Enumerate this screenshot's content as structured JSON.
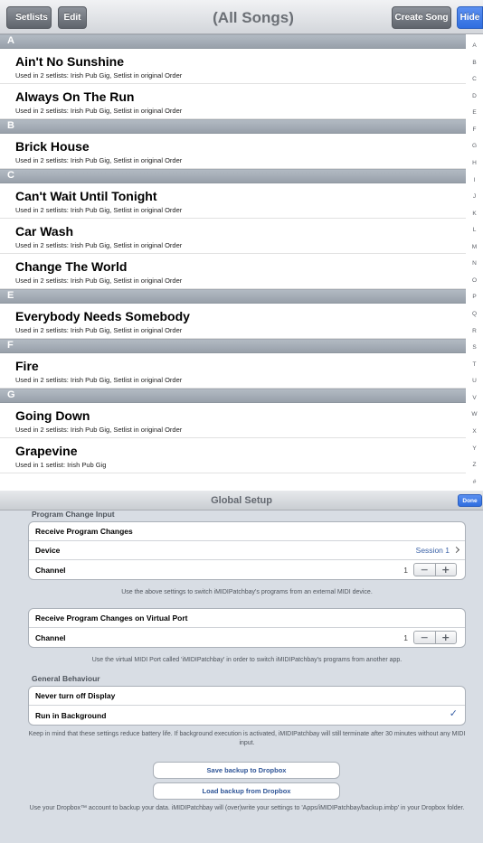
{
  "navbar": {
    "back_label": "Setlists",
    "edit_label": "Edit",
    "title": "(All Songs)",
    "create_label": "Create Song",
    "hide_label": "Hide"
  },
  "sections": [
    {
      "letter": "A",
      "songs": [
        {
          "title": "Ain't No Sunshine",
          "sub": "Used in 2 setlists: Irish Pub Gig, Setlist in original Order"
        },
        {
          "title": "Always On The Run",
          "sub": "Used in 2 setlists: Irish Pub Gig, Setlist in original Order"
        }
      ]
    },
    {
      "letter": "B",
      "songs": [
        {
          "title": "Brick House",
          "sub": "Used in 2 setlists: Irish Pub Gig, Setlist in original Order"
        }
      ]
    },
    {
      "letter": "C",
      "songs": [
        {
          "title": "Can't Wait Until Tonight",
          "sub": "Used in 2 setlists: Irish Pub Gig, Setlist in original Order"
        },
        {
          "title": "Car Wash",
          "sub": "Used in 2 setlists: Irish Pub Gig, Setlist in original Order"
        },
        {
          "title": "Change The World",
          "sub": "Used in 2 setlists: Irish Pub Gig, Setlist in original Order"
        }
      ]
    },
    {
      "letter": "E",
      "songs": [
        {
          "title": "Everybody Needs Somebody",
          "sub": "Used in 2 setlists: Irish Pub Gig, Setlist in original Order"
        }
      ]
    },
    {
      "letter": "F",
      "songs": [
        {
          "title": "Fire",
          "sub": "Used in 2 setlists: Irish Pub Gig, Setlist in original Order"
        }
      ]
    },
    {
      "letter": "G",
      "songs": [
        {
          "title": "Going Down",
          "sub": "Used in 2 setlists: Irish Pub Gig, Setlist in original Order"
        },
        {
          "title": "Grapevine",
          "sub": "Used in 1 setlist: Irish Pub Gig"
        }
      ]
    }
  ],
  "index_letters": [
    "A",
    "B",
    "C",
    "D",
    "E",
    "F",
    "G",
    "H",
    "I",
    "J",
    "K",
    "L",
    "M",
    "N",
    "O",
    "P",
    "Q",
    "R",
    "S",
    "T",
    "U",
    "V",
    "W",
    "X",
    "Y",
    "Z",
    "#"
  ],
  "setup": {
    "title": "Global Setup",
    "done_label": "Done",
    "program_change_header": "Program Change Input",
    "receive_program_changes": "Receive Program Changes",
    "device_label": "Device",
    "device_value": "Session 1",
    "channel_label": "Channel",
    "channel_value": "1",
    "note_external": "Use the above settings to switch iMIDIPatchbay's programs from an external MIDI device.",
    "receive_virtual": "Receive Program Changes on Virtual Port",
    "virtual_channel_label": "Channel",
    "virtual_channel_value": "1",
    "note_virtual": "Use the virtual MIDI Port called 'iMIDIPatchbay' in order to switch iMIDIPatchbay's programs from another app.",
    "general_header": "General Behaviour",
    "never_turn_off_display": "Never turn off Display",
    "run_in_background": "Run in Background",
    "note_battery": "Keep in mind that these settings reduce battery life. If background execution is activated, iMIDIPatchbay will still terminate after 30 minutes without any MIDI input.",
    "save_backup": "Save backup to Dropbox",
    "load_backup": "Load backup from Dropbox",
    "note_dropbox": "Use your Dropbox™ account to backup your data. iMIDIPatchbay will (over)write your settings to 'Apps/iMIDIPatchbay/backup.imbp' in your Dropbox folder.",
    "stepper_minus": "−",
    "stepper_plus": "+",
    "checkmark": "✓"
  }
}
